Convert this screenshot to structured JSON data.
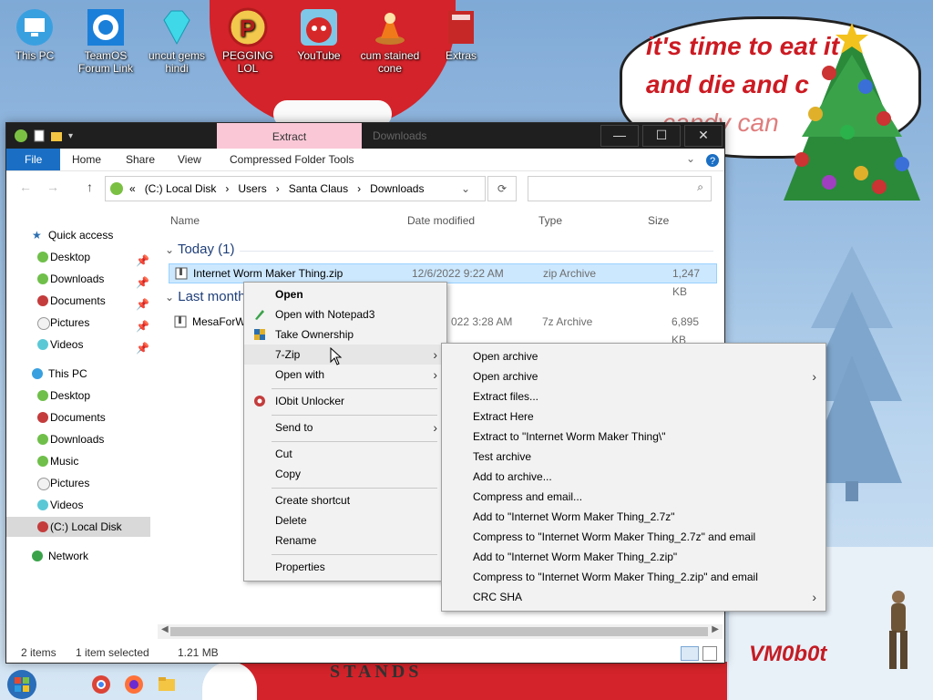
{
  "desktop": {
    "icons": [
      {
        "label": "This PC",
        "name": "this-pc"
      },
      {
        "label": "TeamOS Forum Link",
        "name": "teamos-forum-link"
      },
      {
        "label": "uncut gems hindi",
        "name": "uncut-gems-hindi"
      },
      {
        "label": "PEGGING LOL",
        "name": "pegging-lol"
      },
      {
        "label": "YouTube",
        "name": "youtube"
      },
      {
        "label": "cum stained cone",
        "name": "cum-stained-cone"
      },
      {
        "label": "Extras",
        "name": "extras"
      }
    ],
    "speech_lines": [
      "it's time to eat it",
      "and die and c",
      "candy can"
    ],
    "watermark": "VM0b0t",
    "banner_text": "STANDS"
  },
  "explorer": {
    "ribbon_context_tab": "Extract",
    "window_title": "Downloads",
    "tabs": [
      "File",
      "Home",
      "Share",
      "View",
      "Compressed Folder Tools"
    ],
    "breadcrumb": [
      "«",
      "(C:) Local Disk",
      "Users",
      "Santa Claus",
      "Downloads"
    ],
    "columns": {
      "name": "Name",
      "date": "Date modified",
      "type": "Type",
      "size": "Size"
    },
    "groups": [
      {
        "label": "Today (1)"
      },
      {
        "label": "Last month"
      }
    ],
    "files": [
      {
        "name": "Internet Worm Maker Thing.zip",
        "date": "12/6/2022 9:22 AM",
        "type": "zip Archive",
        "size": "1,247 KB"
      },
      {
        "name": "MesaForWi",
        "date": "022 3:28 AM",
        "type": "7z Archive",
        "size": "6,895 KB"
      }
    ],
    "nav": {
      "quick_access": "Quick access",
      "quick_items": [
        "Desktop",
        "Downloads",
        "Documents",
        "Pictures",
        "Videos"
      ],
      "this_pc": "This PC",
      "pc_items": [
        "Desktop",
        "Documents",
        "Downloads",
        "Music",
        "Pictures",
        "Videos",
        "(C:) Local Disk"
      ],
      "network": "Network"
    },
    "status": {
      "items": "2 items",
      "selected": "1 item selected",
      "size": "1.21 MB"
    }
  },
  "context_menu": {
    "items": [
      "Open",
      "Open with Notepad3",
      "Take Ownership",
      "7-Zip",
      "Open with",
      "IObit Unlocker",
      "Send to",
      "Cut",
      "Copy",
      "Create shortcut",
      "Delete",
      "Rename",
      "Properties"
    ]
  },
  "sevenzip_menu": {
    "items": [
      "Open archive",
      "Open archive",
      "Extract files...",
      "Extract Here",
      "Extract to \"Internet Worm Maker Thing\\\"",
      "Test archive",
      "Add to archive...",
      "Compress and email...",
      "Add to \"Internet Worm Maker Thing_2.7z\"",
      "Compress to \"Internet Worm Maker Thing_2.7z\" and email",
      "Add to \"Internet Worm Maker Thing_2.zip\"",
      "Compress to \"Internet Worm Maker Thing_2.zip\" and email",
      "CRC SHA"
    ]
  },
  "colors": {
    "accent": "#1a6fc4",
    "selection": "#cce8ff",
    "extract_tab": "#f9c7d6"
  }
}
